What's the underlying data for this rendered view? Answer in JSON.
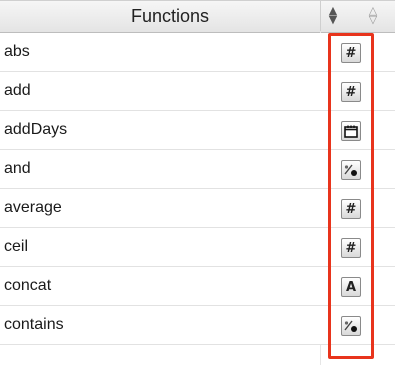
{
  "header": {
    "title": "Functions"
  },
  "functions": [
    {
      "name": "abs",
      "type_icon": "number-icon",
      "glyph": "#"
    },
    {
      "name": "add",
      "type_icon": "number-icon",
      "glyph": "#"
    },
    {
      "name": "addDays",
      "type_icon": "calendar-icon",
      "glyph": ""
    },
    {
      "name": "and",
      "type_icon": "boolean-icon",
      "glyph": "%"
    },
    {
      "name": "average",
      "type_icon": "number-icon",
      "glyph": "#"
    },
    {
      "name": "ceil",
      "type_icon": "number-icon",
      "glyph": "#"
    },
    {
      "name": "concat",
      "type_icon": "text-icon",
      "glyph": "A"
    },
    {
      "name": "contains",
      "type_icon": "boolean-icon",
      "glyph": "%"
    }
  ],
  "colors": {
    "highlight": "#e8341c"
  }
}
